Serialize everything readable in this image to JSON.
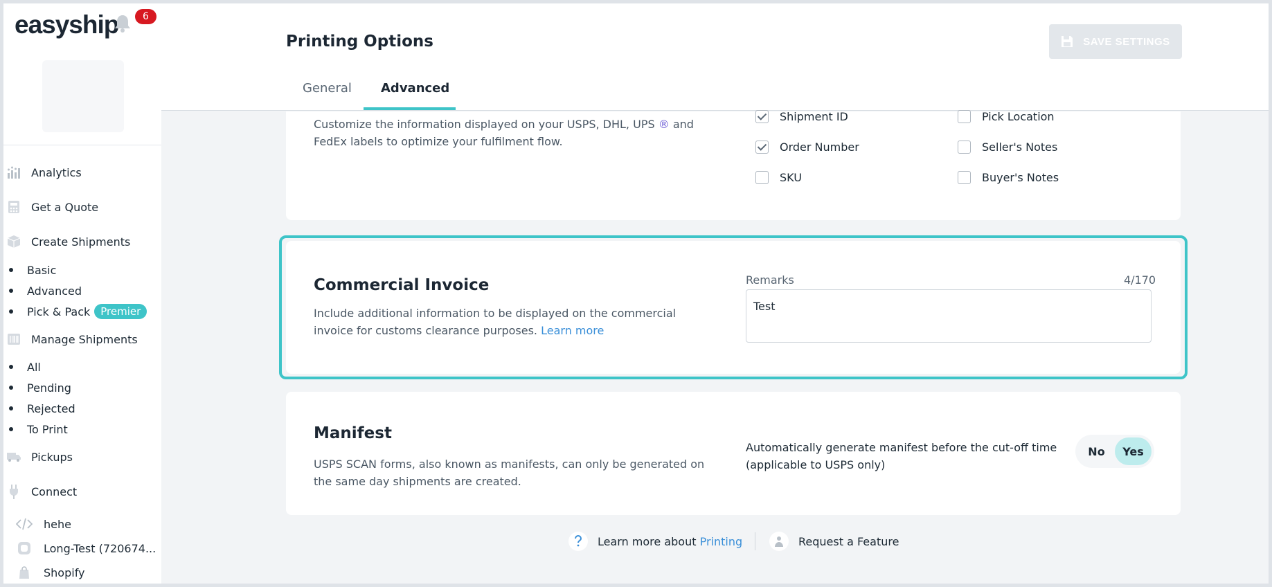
{
  "brand": {
    "logo": "easyship",
    "notification_count": "6"
  },
  "sidebar": {
    "nav": [
      {
        "label": "Analytics",
        "icon": "bar-chart-icon"
      },
      {
        "label": "Get a Quote",
        "icon": "calculator-icon"
      },
      {
        "label": "Create Shipments",
        "icon": "box-icon"
      },
      {
        "label": "Manage Shipments",
        "icon": "barcode-icon"
      },
      {
        "label": "Pickups",
        "icon": "truck-icon"
      },
      {
        "label": "Connect",
        "icon": "plug-icon"
      }
    ],
    "create_sub": [
      "Basic",
      "Advanced",
      "Pick & Pack"
    ],
    "premier_badge": "Premier",
    "manage_sub": [
      "All",
      "Pending",
      "Rejected",
      "To Print"
    ],
    "stores": [
      {
        "label": "hehe",
        "icon": "code-icon"
      },
      {
        "label": "Long-Test (720674...",
        "icon": "store-icon"
      },
      {
        "label": "Shopify",
        "icon": "shopify-icon"
      }
    ]
  },
  "header": {
    "title": "Printing Options",
    "save_label": "SAVE SETTINGS",
    "tabs": [
      "General",
      "Advanced"
    ],
    "active_tab": "Advanced"
  },
  "label_card": {
    "desc_line1": "Customize the information displayed on your USPS, DHL, UPS",
    "registered_mark": "®",
    "desc_and": "and",
    "desc_line2": "FedEx labels to optimize your fulfilment flow.",
    "options_left": [
      {
        "label": "Shipment ID",
        "checked": true
      },
      {
        "label": "Order Number",
        "checked": true
      },
      {
        "label": "SKU",
        "checked": false
      }
    ],
    "options_right": [
      {
        "label": "Pick Location",
        "checked": false
      },
      {
        "label": "Seller's Notes",
        "checked": false
      },
      {
        "label": "Buyer's Notes",
        "checked": false
      }
    ]
  },
  "invoice_card": {
    "title": "Commercial Invoice",
    "desc": "Include additional information to be displayed on the commercial invoice for customs clearance purposes.",
    "learn_more": "Learn more",
    "remarks_label": "Remarks",
    "remarks_count": "4/170",
    "remarks_value": "Test"
  },
  "manifest_card": {
    "title": "Manifest",
    "desc": "USPS SCAN forms, also known as manifests, can only be generated on the same day shipments are created.",
    "question": "Automatically generate manifest before the cut-off time (applicable to USPS only)",
    "option_no": "No",
    "option_yes": "Yes",
    "selected": "Yes"
  },
  "footer": {
    "learn_more_prefix": "Learn more about",
    "learn_more_link": "Printing",
    "request_feature": "Request a Feature"
  },
  "colors": {
    "accent": "#3ec4c8",
    "badge": "#d71921",
    "link": "#3a8fd8"
  }
}
